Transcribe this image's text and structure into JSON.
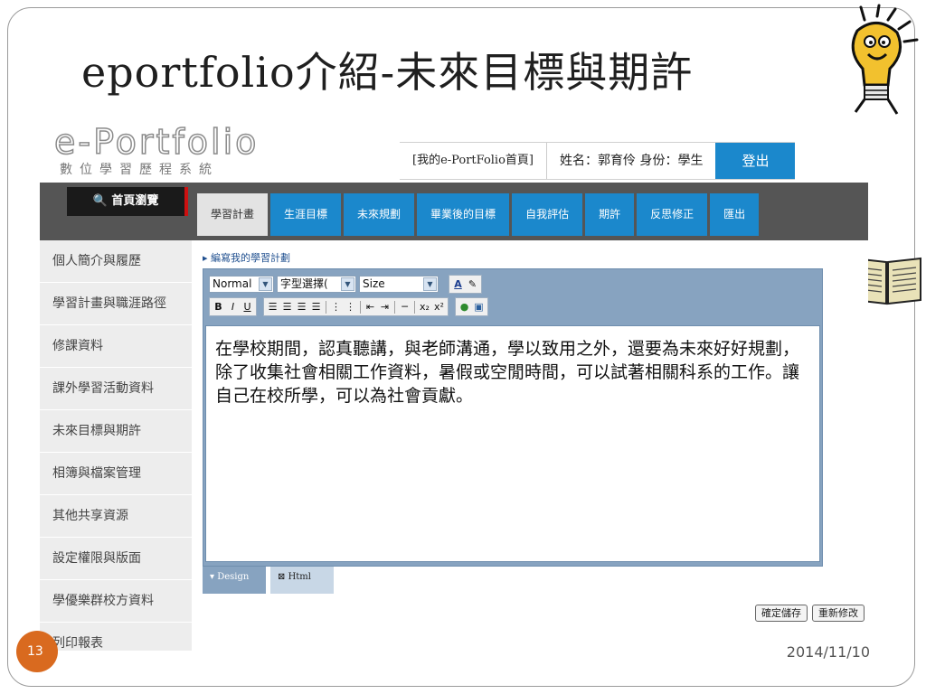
{
  "slide": {
    "title": "eportfolio介紹-未來目標與期許",
    "page_number": "13",
    "date": "2014/11/10"
  },
  "app": {
    "logo": {
      "title": "e-Portfolio",
      "subtitle": "數位學習歷程系統"
    },
    "header": {
      "home_link": "[我的e-PortFolio首頁]",
      "user_info": "姓名：郭育伶  身份：學生",
      "logout": "登出"
    },
    "home_button": "首頁瀏覽",
    "tabs": [
      {
        "label": "學習計畫",
        "active": true
      },
      {
        "label": "生涯目標"
      },
      {
        "label": "未來規劃"
      },
      {
        "label": "畢業後的目標"
      },
      {
        "label": "自我評估"
      },
      {
        "label": "期許"
      },
      {
        "label": "反思修正"
      },
      {
        "label": "匯出"
      }
    ],
    "sidebar": [
      {
        "label": "個人簡介與履歷"
      },
      {
        "label": "學習計畫與職涯路徑"
      },
      {
        "label": "修課資料"
      },
      {
        "label": "課外學習活動資料"
      },
      {
        "label": "未來目標與期許"
      },
      {
        "label": "相簿與檔案管理"
      },
      {
        "label": "其他共享資源"
      },
      {
        "label": "設定權限與版面"
      },
      {
        "label": "學優樂群校方資料"
      },
      {
        "label": "列印報表"
      }
    ],
    "breadcrumb": "▸ 編寫我的學習計劃",
    "editor": {
      "format_select": "Normal",
      "font_select": "字型選擇(",
      "size_select": "Size",
      "content": "在學校期間，認真聽講，與老師溝通，學以致用之外，還要為未來好好規劃，除了收集社會相關工作資料，暑假或空閒時間，可以試著相關科系的工作。讓自己在校所學，可以為社會貢獻。",
      "mode_design": "Design",
      "mode_html": "Html"
    },
    "buttons": {
      "save": "確定儲存",
      "reset": "重新修改"
    }
  },
  "colors": {
    "accent": "#1b88cc",
    "nav_band": "#555555",
    "editor_frame": "#87a3c0",
    "page_badge": "#d96a1f"
  }
}
